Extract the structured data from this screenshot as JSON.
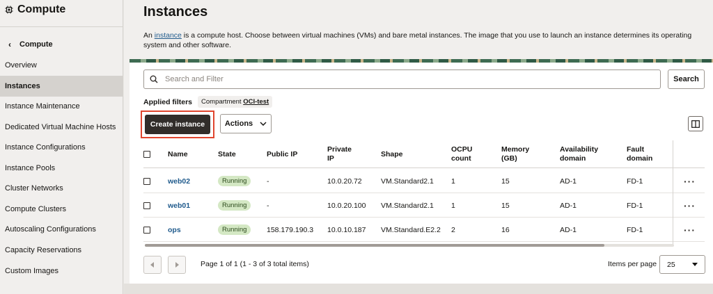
{
  "sidebar": {
    "title": "Compute",
    "back_label": "Compute",
    "items": [
      {
        "label": "Overview",
        "active": false
      },
      {
        "label": "Instances",
        "active": true
      },
      {
        "label": "Instance Maintenance",
        "active": false
      },
      {
        "label": "Dedicated Virtual Machine Hosts",
        "active": false
      },
      {
        "label": "Instance Configurations",
        "active": false
      },
      {
        "label": "Instance Pools",
        "active": false
      },
      {
        "label": "Cluster Networks",
        "active": false
      },
      {
        "label": "Compute Clusters",
        "active": false
      },
      {
        "label": "Autoscaling Configurations",
        "active": false
      },
      {
        "label": "Capacity Reservations",
        "active": false
      },
      {
        "label": "Custom Images",
        "active": false
      }
    ]
  },
  "page": {
    "title": "Instances",
    "intro_prefix": "An ",
    "intro_link": "instance",
    "intro_suffix": " is a compute host. Choose between virtual machines (VMs) and bare metal instances. The image that you use to launch an instance determines its operating system and other software."
  },
  "search": {
    "placeholder": "Search and Filter",
    "button_label": "Search"
  },
  "filters": {
    "label": "Applied filters",
    "chip_key": "Compartment",
    "chip_value": "OCI-test"
  },
  "toolbar": {
    "create_label": "Create instance",
    "actions_label": "Actions"
  },
  "table": {
    "headers": {
      "name": "Name",
      "state": "State",
      "public_ip": "Public IP",
      "private_ip_1": "Private",
      "private_ip_2": "IP",
      "shape": "Shape",
      "ocpu_1": "OCPU",
      "ocpu_2": "count",
      "memory_1": "Memory",
      "memory_2": "(GB)",
      "ad_1": "Availability",
      "ad_2": "domain",
      "fd_1": "Fault",
      "fd_2": "domain"
    },
    "rows": [
      {
        "name": "web02",
        "state": "Running",
        "public_ip": "-",
        "private_ip": "10.0.20.72",
        "shape": "VM.Standard2.1",
        "ocpu": "1",
        "memory": "15",
        "ad": "AD-1",
        "fd": "FD-1"
      },
      {
        "name": "web01",
        "state": "Running",
        "public_ip": "-",
        "private_ip": "10.0.20.100",
        "shape": "VM.Standard2.1",
        "ocpu": "1",
        "memory": "15",
        "ad": "AD-1",
        "fd": "FD-1"
      },
      {
        "name": "ops",
        "state": "Running",
        "public_ip": "158.179.190.3",
        "private_ip": "10.0.10.187",
        "shape": "VM.Standard.E2.2",
        "ocpu": "2",
        "memory": "16",
        "ad": "AD-1",
        "fd": "FD-1"
      }
    ]
  },
  "pagination": {
    "text": "Page 1 of 1 (1 - 3 of 3 total items)",
    "items_per_page_label": "Items per page",
    "items_per_page_value": "25"
  },
  "colors": {
    "primary_button": "#312d2a",
    "highlight_border": "#e0452e",
    "link": "#1f5a8c",
    "running_badge": "#d4e8c4"
  }
}
